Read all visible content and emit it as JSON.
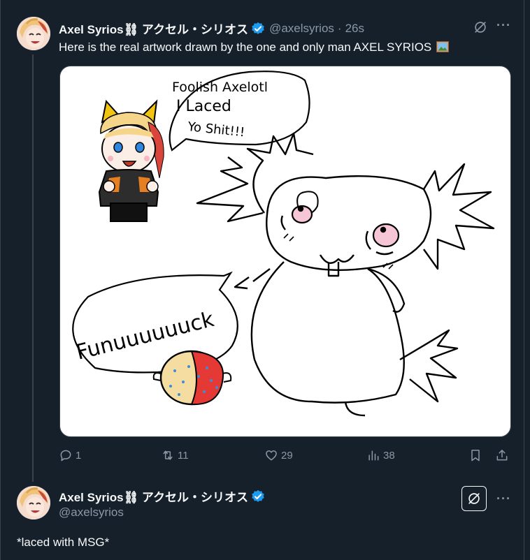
{
  "tweet1": {
    "display_name": "Axel Syrios⛓ アクセル・シリオス",
    "handle": "@axelsyrios",
    "separator": "·",
    "time": "26s",
    "text": "Here is the real artwork drawn by the one and only man AXEL SYRIOS",
    "media": {
      "speech_bubble_lines": [
        "Foolish Axelotl",
        "I Laced",
        "Yo Shit!!!"
      ],
      "scream_text": "Funuuuuuuck"
    },
    "actions": {
      "replies": "1",
      "reposts": "11",
      "likes": "29",
      "views": "38"
    },
    "icons": [
      "grok-icon",
      "more-icon",
      "reply-icon",
      "repost-icon",
      "like-icon",
      "views-icon",
      "bookmark-icon",
      "share-icon"
    ]
  },
  "tweet2": {
    "display_name": "Axel Syrios⛓ アクセル・シリオス",
    "handle": "@axelsyrios",
    "text": "*laced with MSG*"
  },
  "colors": {
    "background": "#15202b",
    "text": "#f7f9f9",
    "secondary": "#8b98a5",
    "verified": "#1d9bf0",
    "border": "#38444d"
  }
}
